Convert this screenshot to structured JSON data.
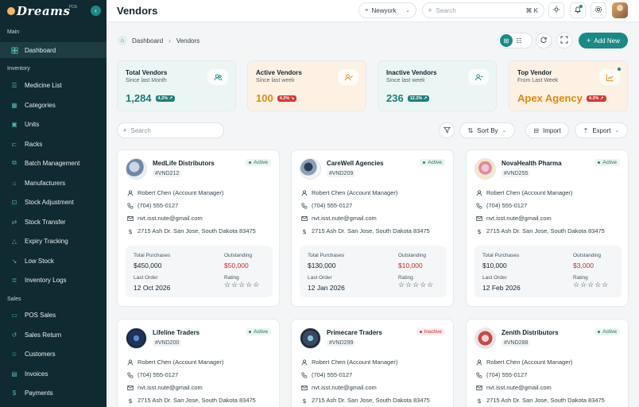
{
  "brand": {
    "name": "Dreams",
    "badge": "POS",
    "accent": "#1b8a86",
    "sidebar_bg": "#0f2a30"
  },
  "sidebar": {
    "sections": [
      {
        "label": "Main",
        "items": [
          {
            "label": "Dashboard",
            "icon": "dashboard-icon",
            "active": true
          }
        ]
      },
      {
        "label": "Inventory",
        "items": [
          {
            "label": "Medicine List",
            "icon": "list-icon"
          },
          {
            "label": "Categories",
            "icon": "grid-icon"
          },
          {
            "label": "Units",
            "icon": "unit-icon"
          },
          {
            "label": "Racks",
            "icon": "rack-icon"
          },
          {
            "label": "Batch Management",
            "icon": "layers-icon"
          },
          {
            "label": "Manufacturers",
            "icon": "factory-icon"
          },
          {
            "label": "Stock Adjustment",
            "icon": "adjust-icon"
          },
          {
            "label": "Stock Transfer",
            "icon": "transfer-icon"
          },
          {
            "label": "Expiry Tracking",
            "icon": "warning-icon"
          },
          {
            "label": "Low Stock",
            "icon": "down-trend-icon"
          },
          {
            "label": "Inventory Logs",
            "icon": "log-icon"
          }
        ]
      },
      {
        "label": "Sales",
        "items": [
          {
            "label": "POS Sales",
            "icon": "monitor-icon"
          },
          {
            "label": "Sales Return",
            "icon": "return-icon"
          },
          {
            "label": "Customers",
            "icon": "users-icon"
          },
          {
            "label": "Invoices",
            "icon": "invoice-icon"
          },
          {
            "label": "Payments",
            "icon": "dollar-icon"
          }
        ]
      }
    ]
  },
  "header": {
    "title": "Vendors",
    "location": "Newyork",
    "search_placeholder": "Search",
    "search_shortcut": "⌘ K"
  },
  "breadcrumb": {
    "home": "Dashboard",
    "current": "Vendors"
  },
  "actions": {
    "add_label": "Add New"
  },
  "stats": [
    {
      "title": "Total Vendors",
      "sub": "Since last Month",
      "value": "1,284",
      "badge": "4.2% ↗",
      "trend": "up",
      "value_color": "#1b7d79",
      "bg": "#eaf5f4",
      "icon": "users-icon"
    },
    {
      "title": "Active Vendors",
      "sub": "Since last week",
      "value": "100",
      "badge": "4.2% ↘",
      "trend": "down",
      "value_color": "#e08a12",
      "bg": "#fdf1e3",
      "icon": "user-check-icon"
    },
    {
      "title": "Inactive Vendors",
      "sub": "Since last week",
      "value": "236",
      "badge": "12.2% ↗",
      "trend": "up",
      "value_color": "#1b7d79",
      "bg": "#eaf5f4",
      "icon": "user-minus-icon"
    },
    {
      "title": "Top Vendor",
      "sub": "From Last Week",
      "value": "Apex Agency",
      "badge": "4.2% ↗",
      "trend": "down",
      "value_color": "#e08a12",
      "bg": "#fdf1e3",
      "icon": "chart-icon"
    }
  ],
  "toolbar": {
    "search_placeholder": "Search",
    "sort_label": "Sort By",
    "import_label": "Import",
    "export_label": "Export"
  },
  "labels": {
    "total_purchases": "Total Purchases",
    "outstanding": "Outstanding",
    "last_order": "Last Order",
    "rating": "Rating"
  },
  "vendors": [
    {
      "name": "MedLife Distributors",
      "code": "#VND212",
      "status": "Active",
      "manager": "Robert Chen (Account Manager)",
      "phone": "(704) 555-0127",
      "email": "nvt.isst.nute@gmail.com",
      "address": "2715 Ash Dr. San Jose, South Dakota 83475",
      "total": "$450,000",
      "outstanding": "$50,000",
      "last_order": "12 Oct 2026",
      "stars": "☆☆☆☆☆"
    },
    {
      "name": "CareWell Agencies",
      "code": "#VND209",
      "status": "Active",
      "manager": "Robert Chen (Account Manager)",
      "phone": "(704) 555-0127",
      "email": "nvt.isst.nute@gmail.com",
      "address": "2715 Ash Dr. San Jose, South Dakota 83475",
      "total": "$130,000",
      "outstanding": "$10,000",
      "last_order": "12 Jan 2026",
      "stars": "☆☆☆☆☆"
    },
    {
      "name": "NovaHealth Pharma",
      "code": "#VND255",
      "status": "Active",
      "manager": "Robert Chen (Account Manager)",
      "phone": "(704) 555-0127",
      "email": "nvt.isst.nute@gmail.com",
      "address": "2715 Ash Dr. San Jose, South Dakota 83475",
      "total": "$10,000",
      "outstanding": "$3,000",
      "last_order": "12 Feb 2026",
      "stars": "☆☆☆☆☆"
    },
    {
      "name": "Lifeline Traders",
      "code": "#VND200",
      "status": "Active",
      "manager": "Robert Chen (Account Manager)",
      "phone": "(704) 555-0127",
      "email": "nvt.isst.nute@gmail.com",
      "address": "2715 Ash Dr. San Jose, South Dakota 83475"
    },
    {
      "name": "Primecare Traders",
      "code": "#VND299",
      "status": "Inactive",
      "manager": "Robert Chen (Account Manager)",
      "phone": "(704) 555-0127",
      "email": "nvt.isst.nute@gmail.com",
      "address": "2715 Ash Dr. San Jose, South Dakota 83475"
    },
    {
      "name": "Zenith Distributors",
      "code": "#VND288",
      "status": "Active",
      "manager": "Robert Chen (Account Manager)",
      "phone": "(704) 555-0127",
      "email": "nvt.isst.nute@gmail.com",
      "address": "2715 Ash Dr. San Jose, South Dakota 83475"
    }
  ]
}
